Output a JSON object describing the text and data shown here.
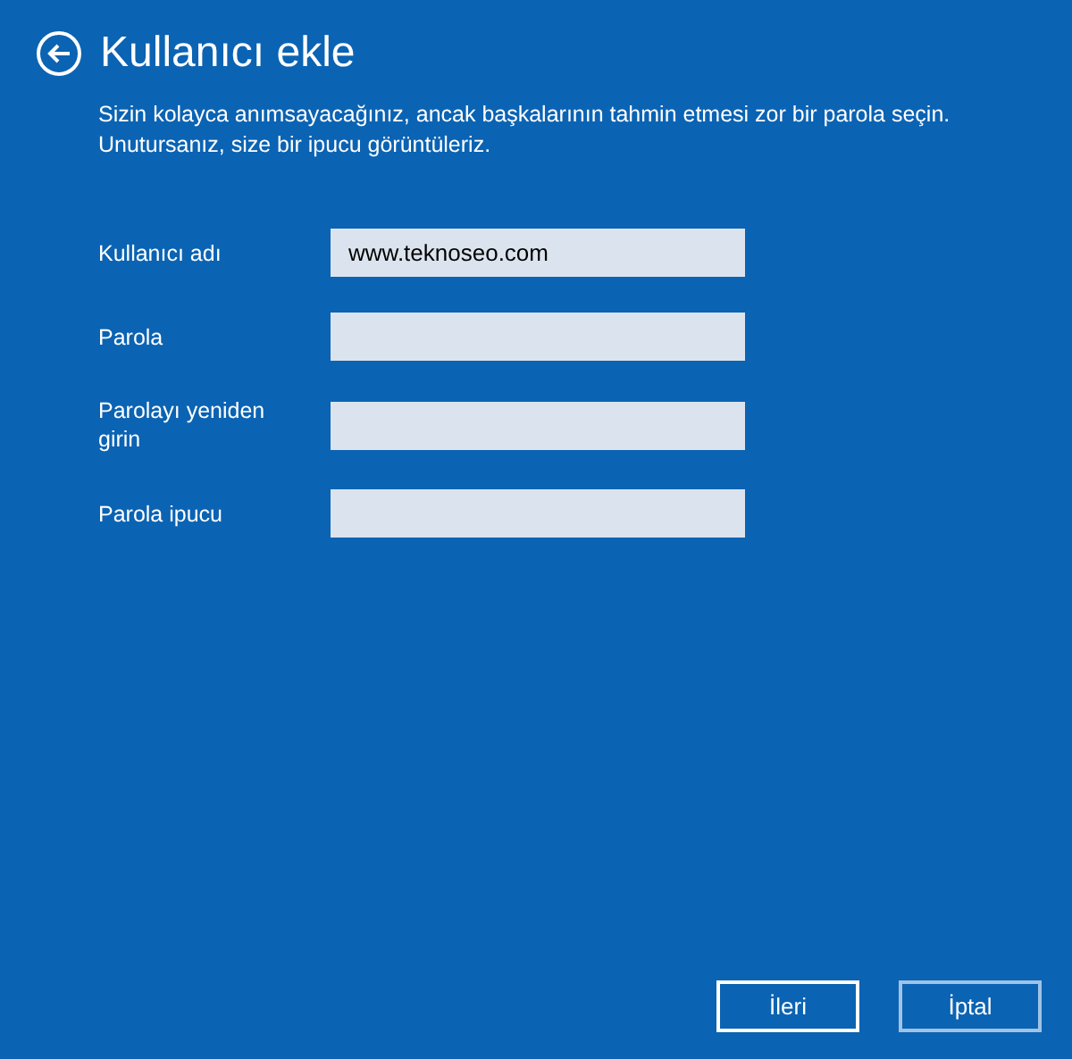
{
  "title": "Kullanıcı ekle",
  "description": "Sizin kolayca anımsayacağınız, ancak başkalarının tahmin etmesi zor bir parola seçin. Unutursanız, size bir ipucu görüntüleriz.",
  "fields": [
    {
      "label": "Kullanıcı adı",
      "value": "www.teknoseo.com"
    },
    {
      "label": "Parola"
    },
    {
      "label": "Parolayı yeniden girin"
    },
    {
      "label": "Parola ipucu"
    }
  ],
  "buttons": [
    {
      "label": "İleri",
      "default": true
    },
    {
      "label": "İptal",
      "default": false
    }
  ]
}
